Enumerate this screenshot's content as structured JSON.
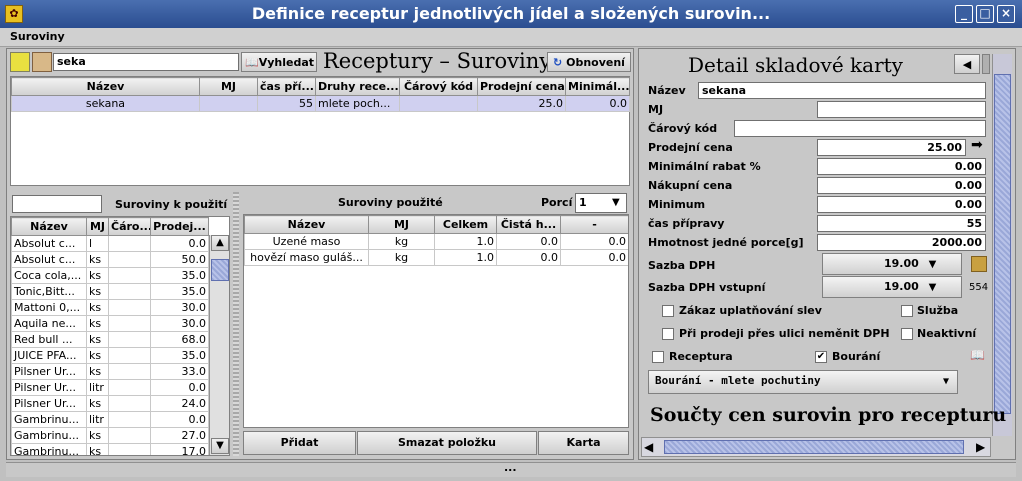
{
  "window": {
    "title": "Definice receptur jednotlivých jídel a složených surovin...",
    "app_icon": "app-icon",
    "minimize": "_",
    "maximize": "□",
    "close": "×"
  },
  "menu": {
    "suroviny": "Suroviny"
  },
  "toolbar": {
    "search_value": "seka",
    "search_button": "Vyhledat",
    "panel_title": "Receptury – Suroviny",
    "refresh_button": "Obnovení"
  },
  "recipes_table": {
    "headers": [
      "Název",
      "MJ",
      "čas pří...",
      "Druhy rece...",
      "Čárový kód",
      "Prodejní cena",
      "Minimál..."
    ],
    "rows": [
      [
        "sekana",
        "",
        "55",
        "mlete  poch...",
        "",
        "25.0",
        "0.0"
      ]
    ]
  },
  "available": {
    "filter_value": "",
    "title": "Suroviny k použití",
    "headers": [
      "Název",
      "MJ",
      "Čáro...",
      "Prodej..."
    ],
    "rows": [
      [
        "Absolut c...",
        "l",
        "",
        "0.0"
      ],
      [
        "Absolut c...",
        "ks",
        "",
        "50.0"
      ],
      [
        "Coca cola,...",
        "ks",
        "",
        "35.0"
      ],
      [
        "Tonic,Bitt...",
        "ks",
        "",
        "35.0"
      ],
      [
        "Mattoni 0,...",
        "ks",
        "",
        "30.0"
      ],
      [
        "Aquila ne...",
        "ks",
        "",
        "30.0"
      ],
      [
        "Red bull ...",
        "ks",
        "",
        "68.0"
      ],
      [
        "JUICE PFA...",
        "ks",
        "",
        "35.0"
      ],
      [
        "Pilsner Ur...",
        "ks",
        "",
        "33.0"
      ],
      [
        "Pilsner Ur...",
        "litr",
        "",
        "0.0"
      ],
      [
        "Pilsner Ur...",
        "ks",
        "",
        "24.0"
      ],
      [
        "Gambrinu...",
        "litr",
        "",
        "0.0"
      ],
      [
        "Gambrinu...",
        "ks",
        "",
        "27.0"
      ],
      [
        "Gambrinu...",
        "ks",
        "",
        "17.0"
      ]
    ]
  },
  "used": {
    "title": "Suroviny použité",
    "portions_label": "Porcí",
    "portions_value": "1",
    "headers": [
      "Název",
      "MJ",
      "Celkem",
      "Čistá h...",
      "-"
    ],
    "rows": [
      [
        "Uzené maso",
        "kg",
        "1.0",
        "0.0",
        "0.0"
      ],
      [
        "hovězí maso guláš...",
        "kg",
        "1.0",
        "0.0",
        "0.0"
      ]
    ],
    "add_button": "Přidat",
    "delete_button": "Smazat položku",
    "card_button": "Karta"
  },
  "detail": {
    "title": "Detail skladové karty",
    "fields": {
      "nazev_label": "Název",
      "nazev": "sekana",
      "mj_label": "MJ",
      "mj": "",
      "carovy_kod_label": "Čárový kód",
      "carovy_kod": "",
      "prodejni_cena_label": "Prodejní cena",
      "prodejni_cena": "25.00",
      "min_rabat_label": "Minimální rabat %",
      "min_rabat": "0.00",
      "nakupni_cena_label": "Nákupní cena",
      "nakupni_cena": "0.00",
      "minimum_label": "Minimum",
      "minimum": "0.00",
      "cas_pripravy_label": "čas přípravy",
      "cas_pripravy": "55",
      "hmotnost_label": "Hmotnost jedné porce[g]",
      "hmotnost": "2000.00",
      "sazba_dph_label": "Sazba DPH",
      "sazba_dph": "19.00",
      "sazba_dph_vstupni_label": "Sazba DPH vstupní",
      "sazba_dph_vstupni": "19.00",
      "vat_code": "554"
    },
    "checks": {
      "zakaz_slev": {
        "label": "Zákaz uplatňování slev",
        "checked": false
      },
      "sluzba": {
        "label": "Služba",
        "checked": false
      },
      "ulice": {
        "label": "Při prodeji přes ulici neměnit DPH",
        "checked": false
      },
      "neaktivni": {
        "label": "Neaktivní",
        "checked": false
      },
      "receptura": {
        "label": "Receptura",
        "checked": false
      },
      "bourani": {
        "label": "Bourání",
        "checked": true
      },
      "check_mark": "✔"
    },
    "combo_value": "Bourání   - mlete  pochutiny",
    "sum_title": "Součty cen surovin pro recepturu"
  },
  "status": {
    "text": "..."
  }
}
